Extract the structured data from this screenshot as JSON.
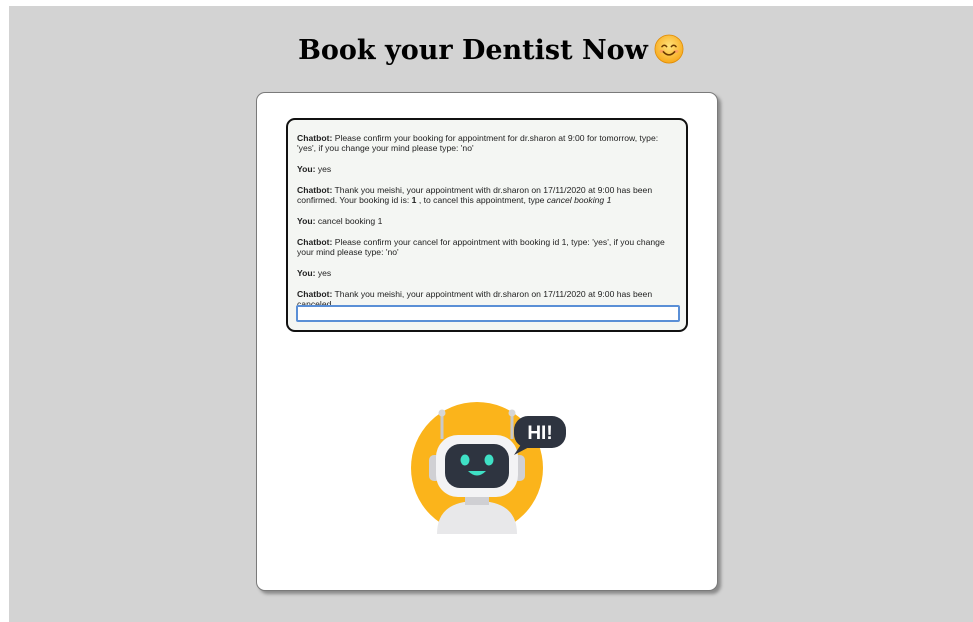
{
  "page": {
    "title": "Book your Dentist Now",
    "title_emoji": "smiling-face-icon"
  },
  "chat": {
    "messages": [
      {
        "speaker": "Chatbot:",
        "text": " Please confirm your booking for appointment for dr.sharon at 9:00 for tomorrow, type: 'yes', if you change your mind please type: 'no'"
      },
      {
        "speaker": "You:",
        "text": " yes"
      },
      {
        "speaker": "Chatbot:",
        "text_before": " Thank you meishi, your appointment with dr.sharon on 17/11/2020 at 9:00 has been confirmed. Your booking id is: ",
        "booking_id": "1",
        "text_middle": " , to cancel this appointment, type ",
        "command": "cancel booking 1"
      },
      {
        "speaker": "You:",
        "text": " cancel booking 1"
      },
      {
        "speaker": "Chatbot:",
        "text": " Please confirm your cancel for appointment with booking id 1, type: 'yes', if you change your mind please type: 'no'"
      },
      {
        "speaker": "You:",
        "text": " yes"
      },
      {
        "speaker": "Chatbot:",
        "text": " Thank you meishi, your appointment with dr.sharon on 17/11/2020 at 9:00 has been canceled."
      }
    ],
    "input_value": "",
    "input_placeholder": ""
  },
  "mascot": {
    "icon": "chatbot-robot-icon",
    "bubble_text": "HI!",
    "colors": {
      "circle": "#fbb41b",
      "bubble": "#2e3440",
      "face": "#2e3440",
      "eyes": "#3fe0c5"
    }
  }
}
